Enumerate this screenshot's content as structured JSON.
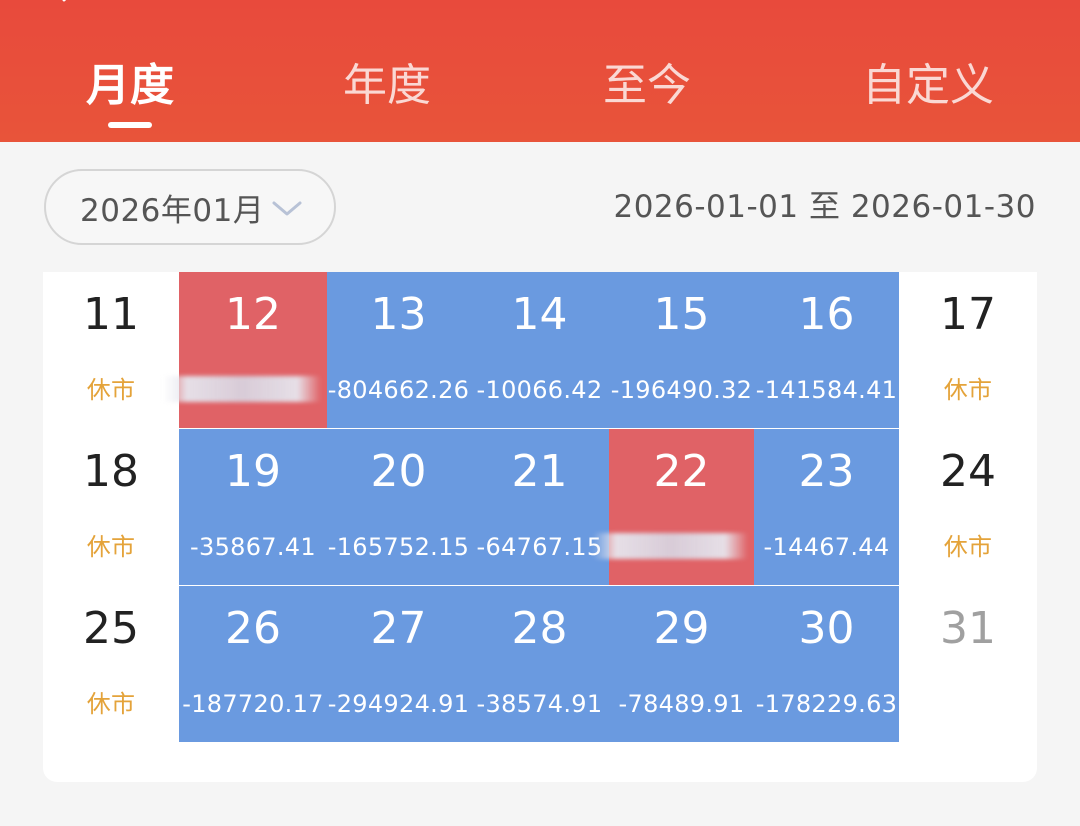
{
  "tabs": [
    {
      "label": "月度",
      "active": true
    },
    {
      "label": "年度",
      "active": false
    },
    {
      "label": "至今",
      "active": false
    },
    {
      "label": "自定义",
      "active": false
    }
  ],
  "month_picker": {
    "label": "2026年01月"
  },
  "date_range": "2026-01-01 至 2026-01-30",
  "closed_label": "休市",
  "colors": {
    "header": "#e84a3c",
    "gain": "#e06266",
    "loss": "#6a9ae0",
    "closed": "#e4a33a"
  },
  "weeks": [
    [
      {
        "day": "11",
        "value": "休市",
        "type": "closed"
      },
      {
        "day": "12",
        "value": "",
        "type": "gain"
      },
      {
        "day": "13",
        "value": "-804662.26",
        "type": "loss"
      },
      {
        "day": "14",
        "value": "-10066.42",
        "type": "loss"
      },
      {
        "day": "15",
        "value": "-196490.32",
        "type": "loss"
      },
      {
        "day": "16",
        "value": "-141584.41",
        "type": "loss"
      },
      {
        "day": "17",
        "value": "休市",
        "type": "closed"
      }
    ],
    [
      {
        "day": "18",
        "value": "休市",
        "type": "closed"
      },
      {
        "day": "19",
        "value": "-35867.41",
        "type": "loss"
      },
      {
        "day": "20",
        "value": "-165752.15",
        "type": "loss"
      },
      {
        "day": "21",
        "value": "-64767.15",
        "type": "loss"
      },
      {
        "day": "22",
        "value": "",
        "type": "gain"
      },
      {
        "day": "23",
        "value": "-14467.44",
        "type": "loss"
      },
      {
        "day": "24",
        "value": "休市",
        "type": "closed"
      }
    ],
    [
      {
        "day": "25",
        "value": "休市",
        "type": "closed"
      },
      {
        "day": "26",
        "value": "-187720.17",
        "type": "loss"
      },
      {
        "day": "27",
        "value": "-294924.91",
        "type": "loss"
      },
      {
        "day": "28",
        "value": "-38574.91",
        "type": "loss"
      },
      {
        "day": "29",
        "value": "-78489.91",
        "type": "loss"
      },
      {
        "day": "30",
        "value": "-178229.63",
        "type": "loss"
      },
      {
        "day": "31",
        "value": "",
        "type": "future"
      }
    ]
  ]
}
